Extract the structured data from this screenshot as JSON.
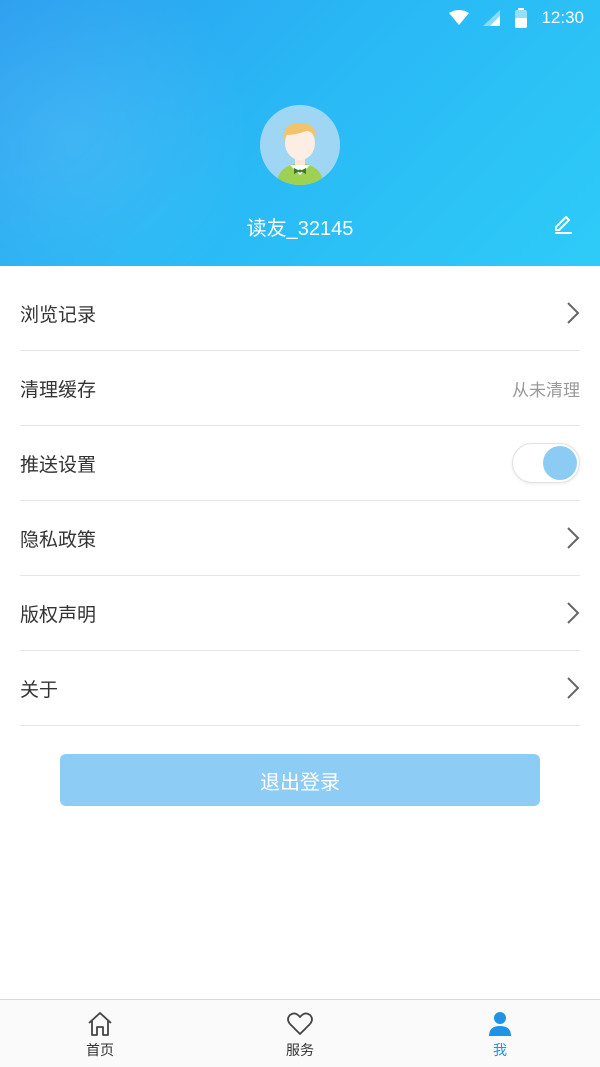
{
  "status_bar": {
    "time": "12:30",
    "icons": [
      "wifi-icon",
      "cellular-signal-icon",
      "battery-icon"
    ]
  },
  "profile": {
    "username": "读友_32145",
    "avatar_icon": "user-avatar-icon",
    "edit_icon": "pencil-icon"
  },
  "menu": {
    "items": [
      {
        "label": "浏览记录",
        "accessory": "chevron-right-icon"
      },
      {
        "label": "清理缓存",
        "value": "从未清理"
      },
      {
        "label": "推送设置",
        "accessory": "toggle",
        "toggle_on": true
      },
      {
        "label": "隐私政策",
        "accessory": "chevron-right-icon"
      },
      {
        "label": "版权声明",
        "accessory": "chevron-right-icon"
      },
      {
        "label": "关于",
        "accessory": "chevron-right-icon"
      }
    ]
  },
  "logout": {
    "label": "退出登录"
  },
  "tabbar": {
    "tabs": [
      {
        "label": "首页",
        "icon": "home-icon"
      },
      {
        "label": "服务",
        "icon": "heart-icon"
      },
      {
        "label": "我",
        "icon": "person-icon",
        "active": true
      }
    ]
  },
  "colors": {
    "header_gradient_start": "#2c9ff0",
    "header_gradient_end": "#2ecbf8",
    "accent": "#1f93e6",
    "button_bg": "#8dccf5",
    "toggle_knob": "#8ccbf4"
  }
}
